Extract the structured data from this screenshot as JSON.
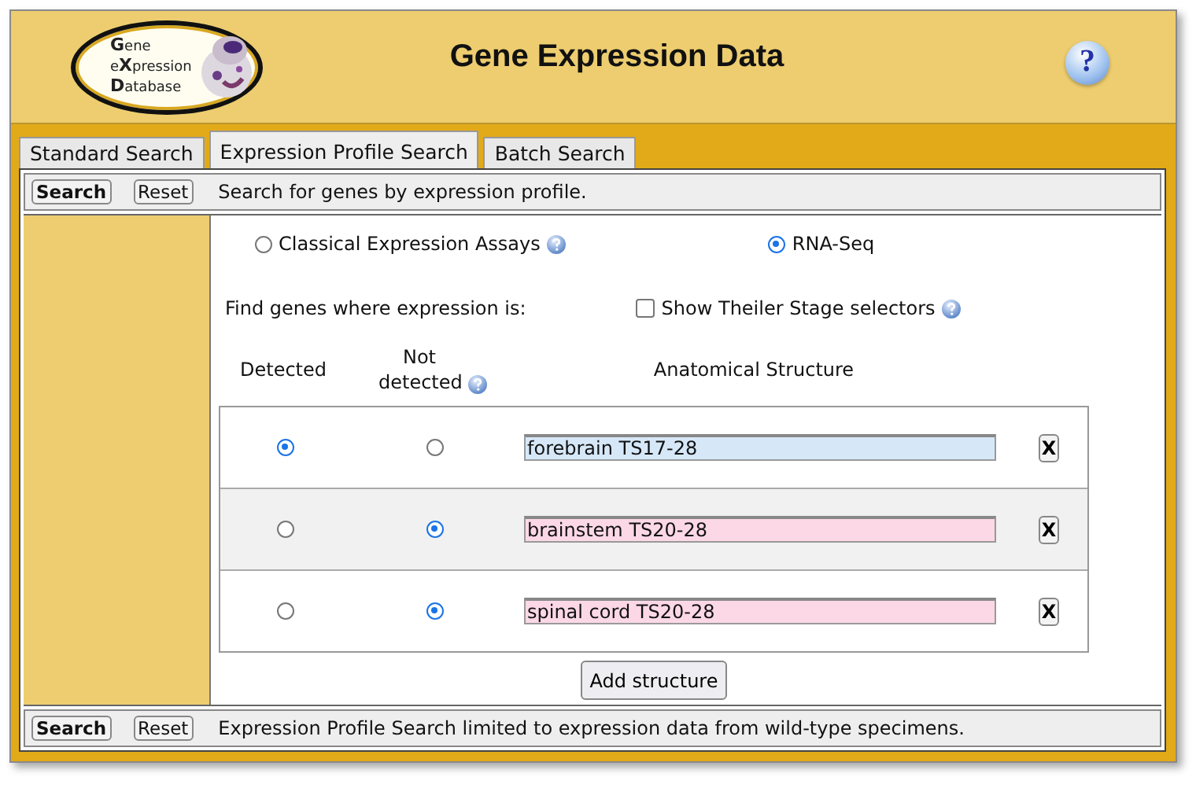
{
  "header": {
    "logo_lines": [
      "**G**ene",
      "e**X**pression",
      "**D**atabase"
    ],
    "title": "Gene Expression Data",
    "help": "?"
  },
  "tabs": [
    {
      "label": "Standard Search",
      "selected": false
    },
    {
      "label": "Expression Profile Search",
      "selected": true
    },
    {
      "label": "Batch Search",
      "selected": false
    }
  ],
  "top_bar": {
    "search": "Search",
    "reset": "Reset",
    "text": "Search for genes by expression profile."
  },
  "data_types": [
    {
      "label": "Classical Expression Assays",
      "selected": false
    },
    {
      "label": "RNA-Seq",
      "selected": true
    }
  ],
  "find_label": "Find genes where expression is:",
  "theiler": {
    "label": "Show Theiler Stage selectors",
    "checked": false
  },
  "columns": {
    "detected": "Detected",
    "not_detected": "Not detected",
    "structure": "Anatomical Structure"
  },
  "rows": [
    {
      "detected": true,
      "structure": "forebrain TS17-28",
      "remove": "X"
    },
    {
      "detected": false,
      "structure": "brainstem TS20-28",
      "remove": "X"
    },
    {
      "detected": false,
      "structure": "spinal cord TS20-28",
      "remove": "X"
    }
  ],
  "add_button": "Add structure",
  "bottom_bar": {
    "search": "Search",
    "reset": "Reset",
    "text": "Expression Profile Search limited to expression data from wild-type specimens."
  }
}
